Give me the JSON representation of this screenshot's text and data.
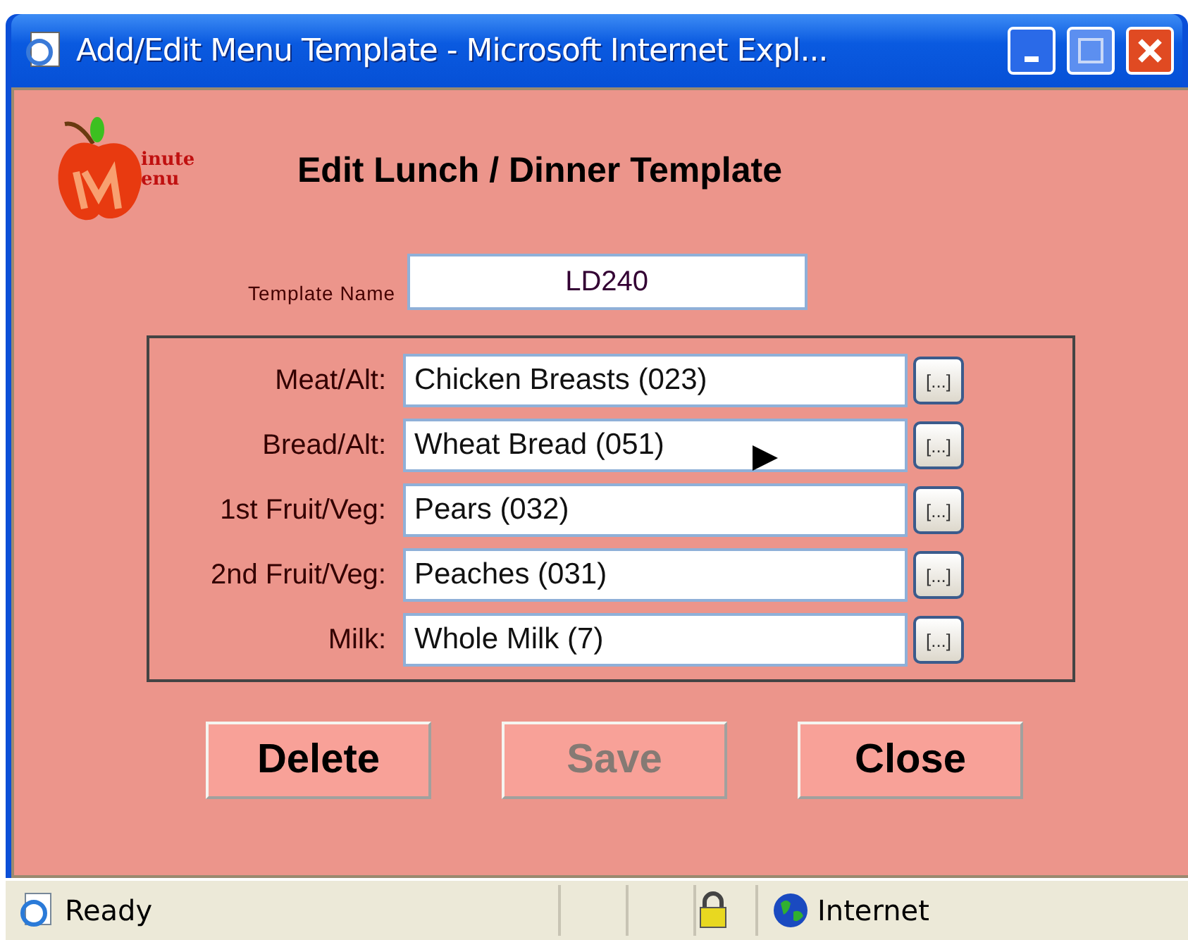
{
  "window": {
    "title": "Add/Edit Menu Template - Microsoft Internet Expl..."
  },
  "logo": {
    "line_1": "inute",
    "line_2": "enu"
  },
  "heading": "Edit Lunch / Dinner Template",
  "template_name": {
    "label": "Template Name",
    "value": "LD240"
  },
  "items": [
    {
      "label": "Meat/Alt:",
      "value": "Chicken Breasts (023)",
      "lookup": "[...]"
    },
    {
      "label": "Bread/Alt:",
      "value": "Wheat Bread (051)",
      "lookup": "[...]"
    },
    {
      "label": "1st Fruit/Veg:",
      "value": "Pears (032)",
      "lookup": "[...]"
    },
    {
      "label": "2nd Fruit/Veg:",
      "value": "Peaches (031)",
      "lookup": "[...]"
    },
    {
      "label": "Milk:",
      "value": "Whole Milk (7)",
      "lookup": "[...]"
    }
  ],
  "buttons": [
    {
      "label": "Delete",
      "disabled": false
    },
    {
      "label": "Save",
      "disabled": true
    },
    {
      "label": "Close",
      "disabled": false
    }
  ],
  "status_bar": {
    "text": "Ready",
    "zone": "Internet"
  }
}
